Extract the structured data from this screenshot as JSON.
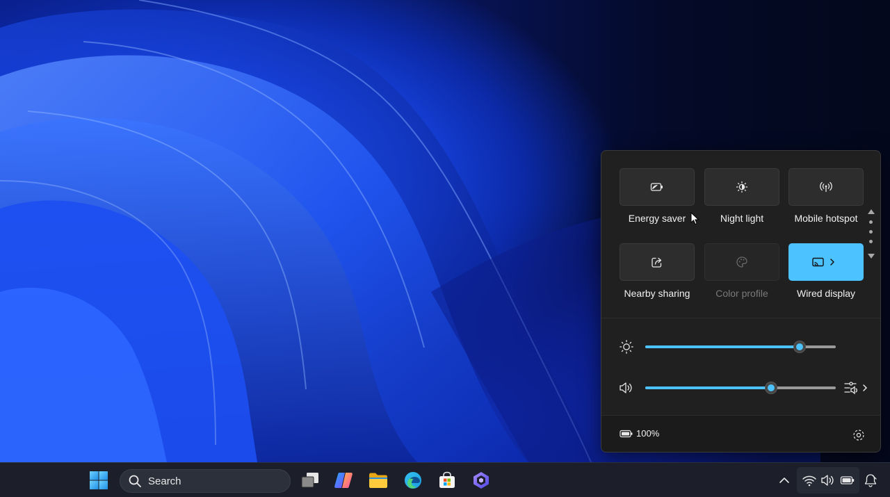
{
  "quick_settings": {
    "tiles": [
      {
        "label": "Energy saver",
        "icon": "energy-saver-icon",
        "state": "off"
      },
      {
        "label": "Night light",
        "icon": "night-light-icon",
        "state": "off"
      },
      {
        "label": "Mobile hotspot",
        "icon": "mobile-hotspot-icon",
        "state": "off"
      },
      {
        "label": "Nearby sharing",
        "icon": "nearby-sharing-icon",
        "state": "off"
      },
      {
        "label": "Color profile",
        "icon": "color-profile-icon",
        "state": "disabled"
      },
      {
        "label": "Wired display",
        "icon": "cast-icon",
        "state": "on"
      }
    ],
    "brightness": {
      "value": 0.81,
      "icon": "brightness-icon"
    },
    "volume": {
      "value": 0.66,
      "icon": "speaker-icon"
    },
    "battery": {
      "percent": "100%",
      "icon": "battery-icon"
    },
    "settings_icon": "gear-icon",
    "accent_color": "#4cc2ff"
  },
  "taskbar": {
    "search_placeholder": "Search",
    "apps": [
      {
        "name": "start-button",
        "icon": "windows-logo-icon"
      },
      {
        "name": "task-view-button",
        "icon": "task-view-icon"
      },
      {
        "name": "copilot-button",
        "icon": "copilot-icon"
      },
      {
        "name": "file-explorer-button",
        "icon": "folder-icon"
      },
      {
        "name": "edge-button",
        "icon": "edge-icon"
      },
      {
        "name": "store-button",
        "icon": "store-icon"
      },
      {
        "name": "bing-button",
        "icon": "bing-icon"
      }
    ],
    "tray": [
      "chevron-up-icon",
      "wifi-icon",
      "volume-icon",
      "battery-icon",
      "notification-icon"
    ]
  }
}
